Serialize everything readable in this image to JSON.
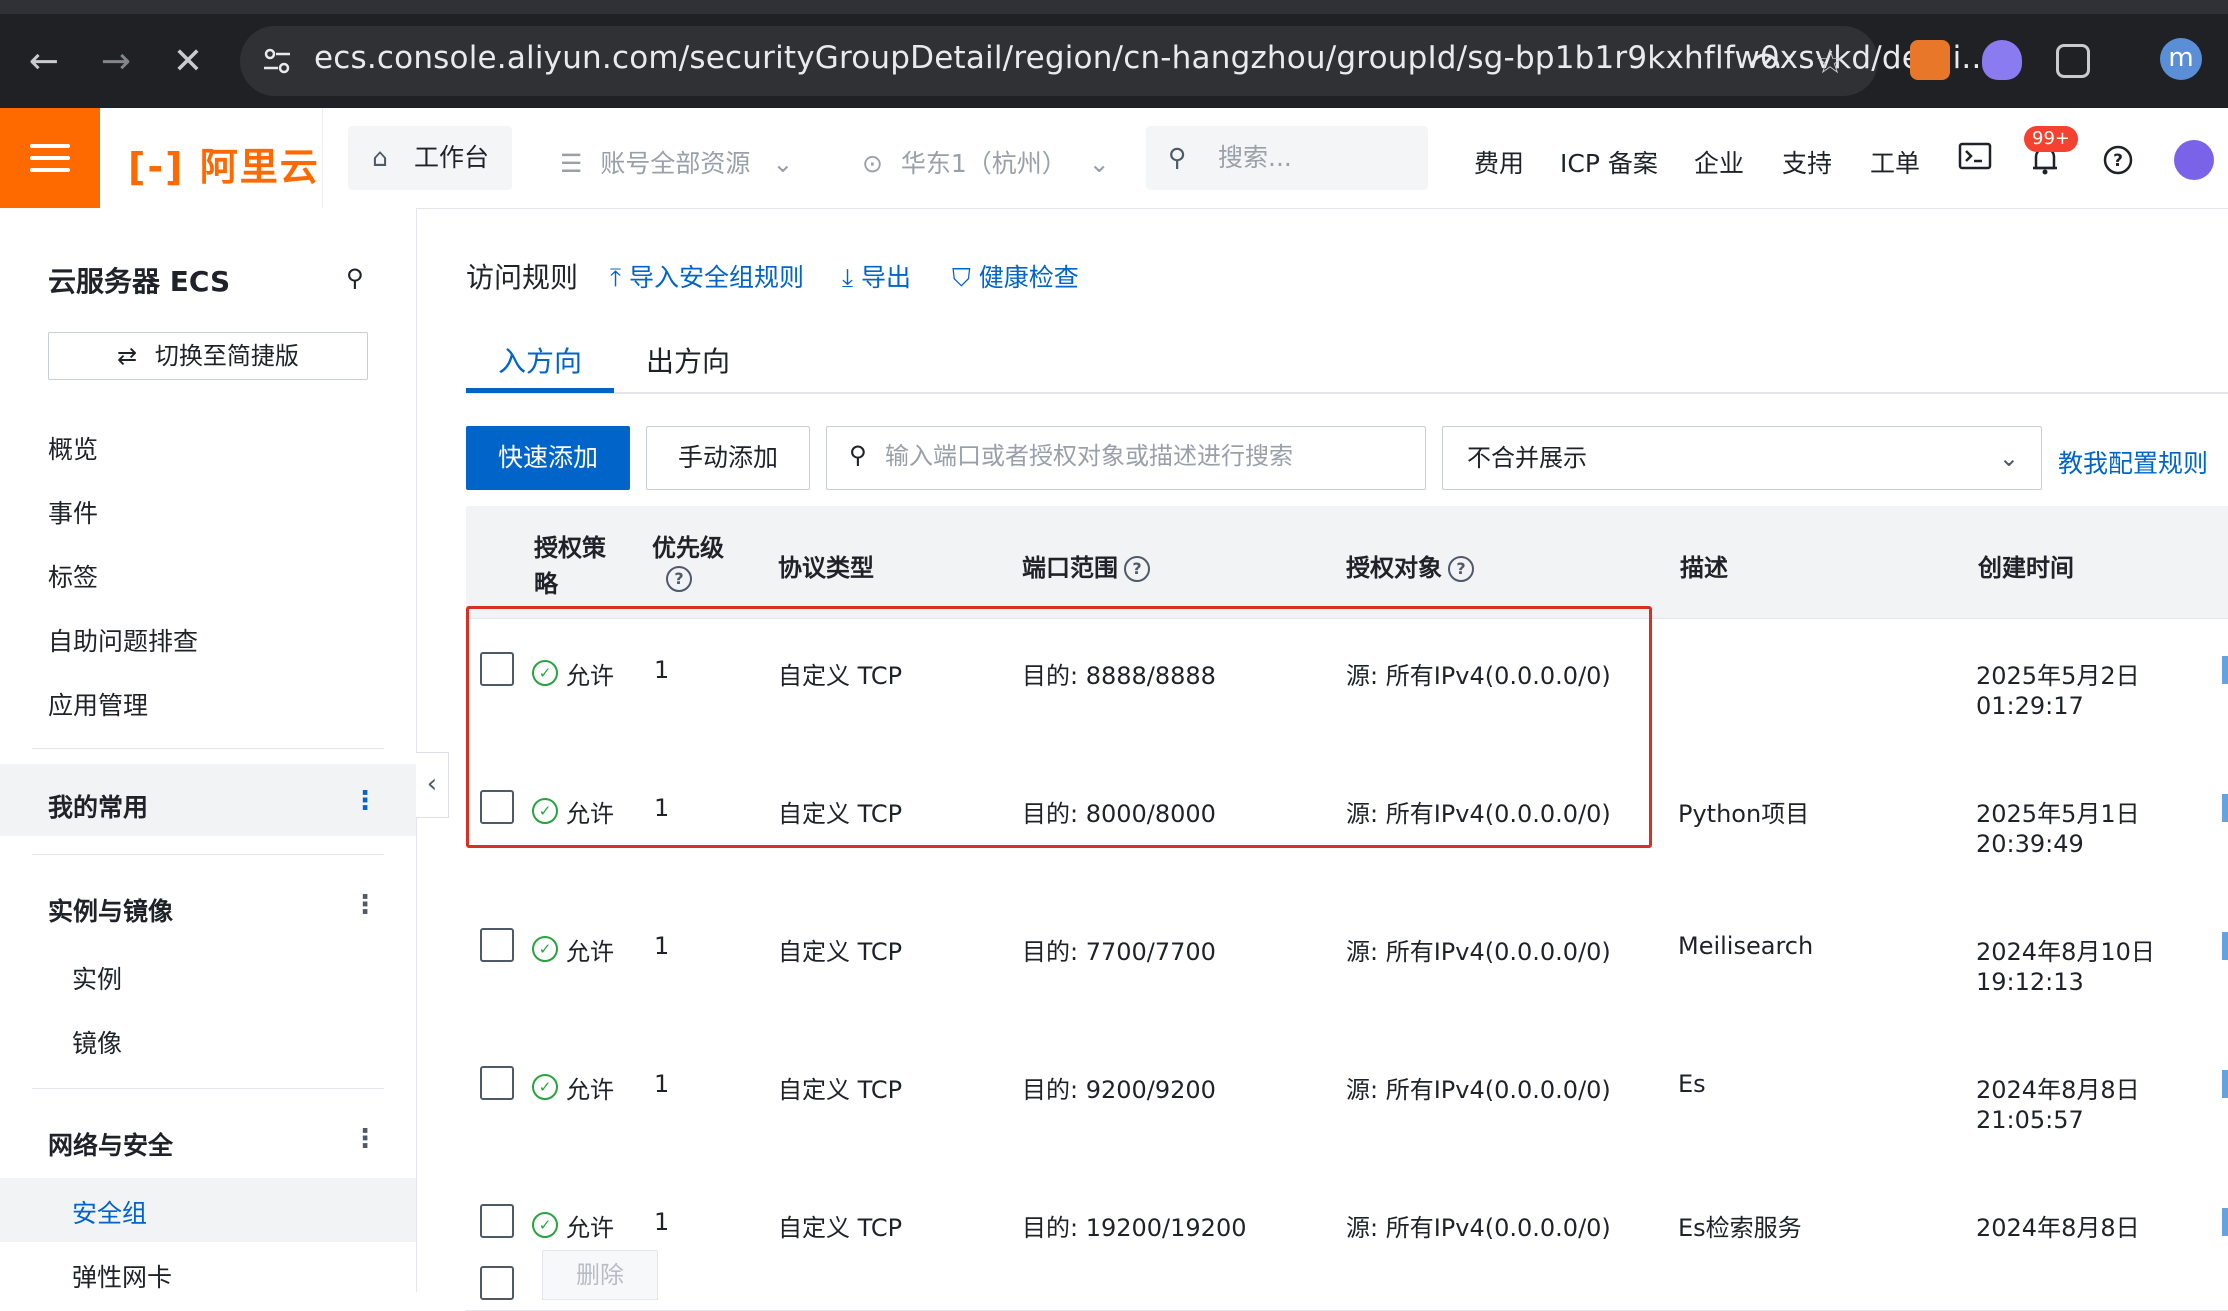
{
  "browser": {
    "url": "ecs.console.aliyun.com/securityGroupDetail/region/cn-hangzhou/groupId/sg-bp1b1r9kxhflfw0xsvkd/detai...",
    "avatar_letter": "m"
  },
  "topbar": {
    "logo": "阿里云",
    "workbench": "工作台",
    "resources": "账号全部资源",
    "region": "华东1（杭州）",
    "search_placeholder": "搜索...",
    "links": [
      "费用",
      "ICP 备案",
      "企业",
      "支持",
      "工单"
    ],
    "notifications_badge": "99+",
    "brand_color": "#ff6a00"
  },
  "sidebar": {
    "title": "云服务器 ECS",
    "switch_label": "切换至简捷版",
    "items": [
      "概览",
      "事件",
      "标签",
      "自助问题排查",
      "应用管理"
    ],
    "favorites": "我的常用",
    "group_instances": "实例与镜像",
    "instances_items": [
      "实例",
      "镜像"
    ],
    "group_network": "网络与安全",
    "network_items": [
      "安全组",
      "弹性网卡"
    ]
  },
  "main": {
    "title": "访问规则",
    "import_link": "导入安全组规则",
    "export_link": "导出",
    "health_link": "健康检查",
    "tabs": [
      "入方向",
      "出方向"
    ],
    "quick_add": "快速添加",
    "manual_add": "手动添加",
    "search_placeholder": "输入端口或者授权对象或描述进行搜索",
    "merge_select": "不合并展示",
    "help_link": "教我配置规则",
    "delete_label": "删除"
  },
  "table": {
    "headers": {
      "policy_line1": "授权策",
      "policy_line2": "略",
      "priority": "优先级",
      "protocol": "协议类型",
      "port": "端口范围",
      "target": "授权对象",
      "desc": "描述",
      "created": "创建时间"
    },
    "rows": [
      {
        "policy": "允许",
        "priority": "1",
        "protocol": "自定义 TCP",
        "port": "目的: 8888/8888",
        "target": "源: 所有IPv4(0.0.0.0/0)",
        "desc": "",
        "date": "2025年5月2日",
        "time": "01:29:17"
      },
      {
        "policy": "允许",
        "priority": "1",
        "protocol": "自定义 TCP",
        "port": "目的: 8000/8000",
        "target": "源: 所有IPv4(0.0.0.0/0)",
        "desc": "Python项目",
        "date": "2025年5月1日",
        "time": "20:39:49"
      },
      {
        "policy": "允许",
        "priority": "1",
        "protocol": "自定义 TCP",
        "port": "目的: 7700/7700",
        "target": "源: 所有IPv4(0.0.0.0/0)",
        "desc": "Meilisearch",
        "date": "2024年8月10日",
        "time": "19:12:13"
      },
      {
        "policy": "允许",
        "priority": "1",
        "protocol": "自定义 TCP",
        "port": "目的: 9200/9200",
        "target": "源: 所有IPv4(0.0.0.0/0)",
        "desc": "Es",
        "date": "2024年8月8日",
        "time": "21:05:57"
      },
      {
        "policy": "允许",
        "priority": "1",
        "protocol": "自定义 TCP",
        "port": "目的: 19200/19200",
        "target": "源: 所有IPv4(0.0.0.0/0)",
        "desc": "Es检索服务",
        "date": "2024年8月8日",
        "time": ""
      }
    ]
  },
  "colors": {
    "accent": "#0064c8",
    "highlight": "#d93026",
    "allow": "#27a33f"
  }
}
